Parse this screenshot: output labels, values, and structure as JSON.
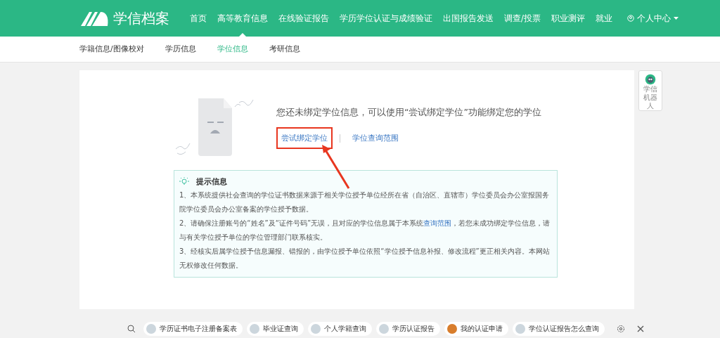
{
  "header": {
    "logo_text": "学信档案",
    "nav": [
      {
        "label": "首页",
        "selected": false
      },
      {
        "label": "高等教育信息",
        "selected": true
      },
      {
        "label": "在线验证报告",
        "selected": false
      },
      {
        "label": "学历学位认证与成绩验证",
        "selected": false
      },
      {
        "label": "出国报告发送",
        "selected": false
      },
      {
        "label": "调查/投票",
        "selected": false
      },
      {
        "label": "职业测评",
        "selected": false
      },
      {
        "label": "就业",
        "selected": false
      }
    ],
    "user_menu": "个人中心"
  },
  "subnav": [
    {
      "label": "学籍信息/图像校对",
      "selected": false
    },
    {
      "label": "学历信息",
      "selected": false
    },
    {
      "label": "学位信息",
      "selected": true
    },
    {
      "label": "考研信息",
      "selected": false
    }
  ],
  "empty_state": {
    "message": "您还未绑定学位信息，可以使用“尝试绑定学位”功能绑定您的学位",
    "links": [
      {
        "label": "尝试绑定学位",
        "highlighted": true
      },
      {
        "label": "学位查询范围",
        "highlighted": false
      }
    ]
  },
  "notice": {
    "title": "提示信息",
    "items": [
      {
        "parts": [
          {
            "text": "1、本系统提供社会查询的学位证书数据来源于相关学位授予单位经所在省（自治区、直辖市）学位委员会办公室报国务院学位委员会办公室备案的学位授予数据。",
            "link": false
          }
        ]
      },
      {
        "parts": [
          {
            "text": "2、请确保注册账号的“姓名”及“证件号码”无误，且对应的学位信息属于本系统",
            "link": false
          },
          {
            "text": "查询范围",
            "link": true
          },
          {
            "text": "，若您未成功绑定学位信息，请与有关学位授予单位的学位管理部门联系核实。",
            "link": false
          }
        ]
      },
      {
        "parts": [
          {
            "text": "3、经核实后属学位授予信息漏报、错报的，由学位授予单位依照“学位授予信息补报、修改流程”更正相关内容。本网站无权修改任何数据。",
            "link": false
          }
        ]
      }
    ]
  },
  "robot": {
    "label": "学信机器人"
  },
  "bottom_bar": {
    "items": [
      "学历证书电子注册备案表",
      "毕业证查询",
      "个人学籍查询",
      "学历认证报告",
      "我的认证申请",
      "学位认证报告怎么查询"
    ]
  }
}
